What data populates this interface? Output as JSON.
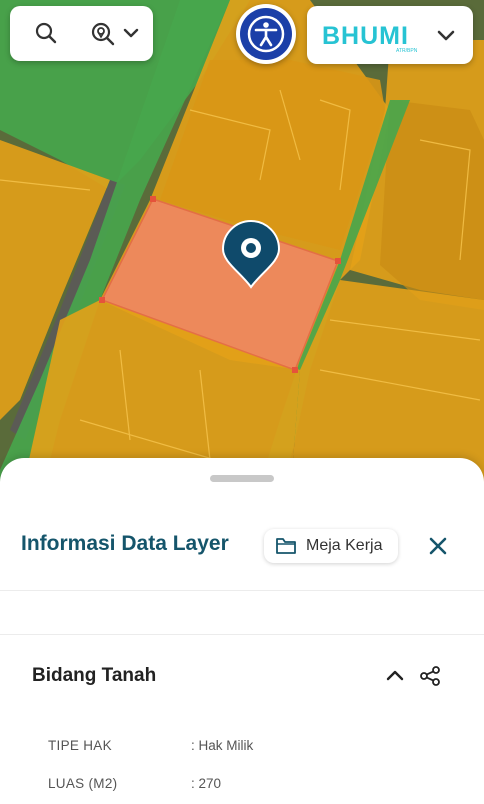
{
  "map": {
    "colors": {
      "green_zone": "#43a047",
      "building_zone": "#e8a21a",
      "selected_parcel": "#f08862",
      "marker": "#0f4a6b"
    }
  },
  "toolbar": {
    "search_icon": "search-icon",
    "zoom_icon": "zoom-location-icon",
    "chevron_icon": "chevron-down-icon",
    "accessibility_icon": "accessibility-icon",
    "brand_logo": "BHUMI"
  },
  "panel": {
    "title": "Informasi Data Layer",
    "workspace_button": "Meja Kerja",
    "section_title": "Bidang Tanah",
    "rows": [
      {
        "key": "TIPE HAK",
        "value": ": Hak Milik"
      },
      {
        "key": "LUAS (M2)",
        "value": ": 270"
      }
    ],
    "accent_color": "#15556b"
  }
}
